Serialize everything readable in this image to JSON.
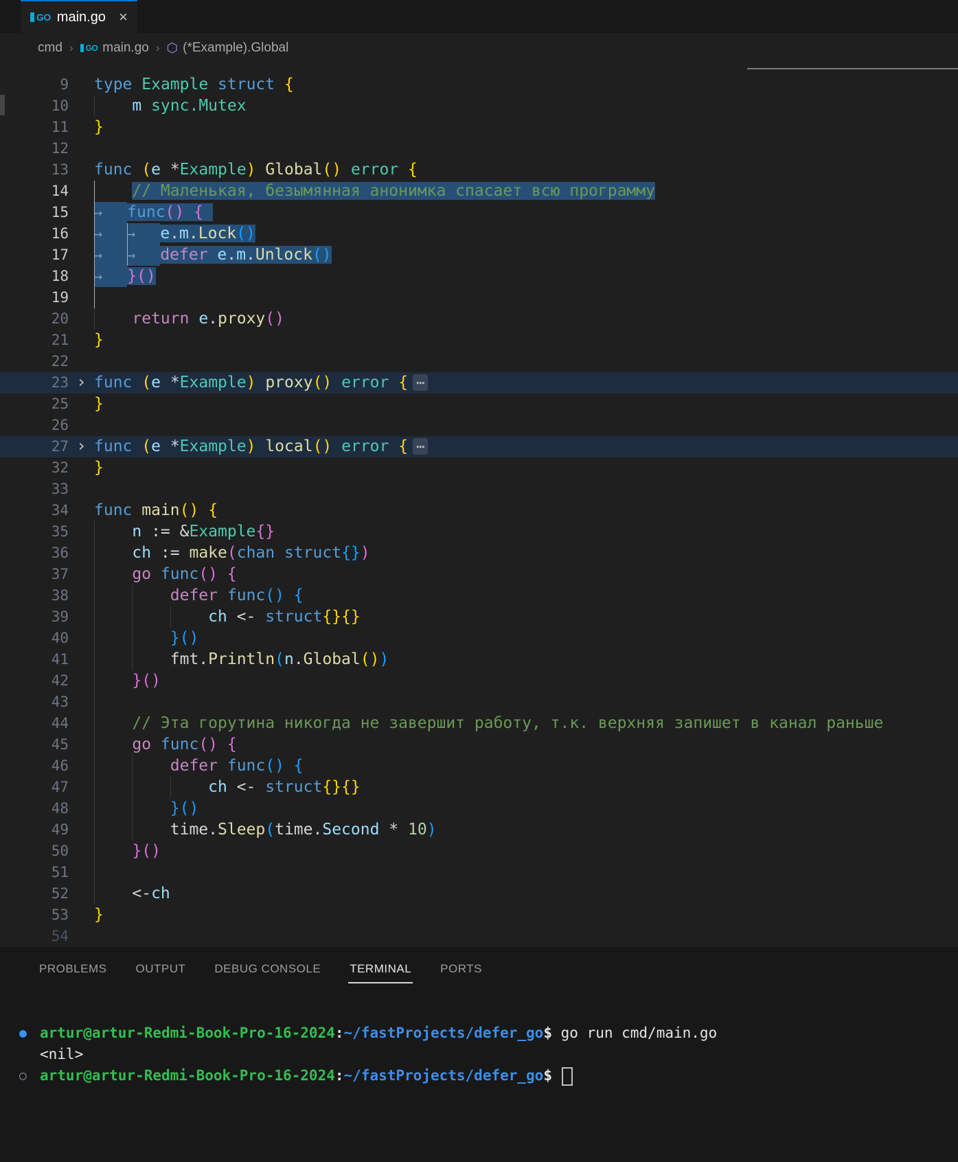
{
  "colors": {
    "accent": "#0078d4",
    "editor_background": "#1f1f1f",
    "panel_background": "#181818",
    "selection": "#264F78",
    "terminal_green": "#2fbf4f",
    "terminal_blue": "#3b8eea",
    "go_brand": "#00acd7"
  },
  "icons": {
    "go": "GO",
    "symbol_method": "⬡",
    "close": "×",
    "crumb_separator": "›",
    "fold_chevron": "›",
    "tab_arrow": "→",
    "fold_ellipsis": "⋯",
    "decoration_filled": "●",
    "decoration_outline": "○"
  },
  "tab": {
    "title": "main.go"
  },
  "breadcrumb": {
    "items": [
      "cmd",
      "main.go",
      "(*Example).Global"
    ]
  },
  "editor": {
    "lines": [
      {
        "n": "9",
        "tokens": [
          {
            "t": "type ",
            "c": "kw"
          },
          {
            "t": "Example ",
            "c": "typ"
          },
          {
            "t": "struct ",
            "c": "kw"
          },
          {
            "t": "{",
            "c": "b1"
          }
        ]
      },
      {
        "n": "10",
        "tokens": [
          {
            "c": "ig"
          },
          {
            "t": "m ",
            "c": "vr"
          },
          {
            "t": "sync.Mutex",
            "c": "typ"
          }
        ]
      },
      {
        "n": "11",
        "tokens": [
          {
            "t": "}",
            "c": "b1"
          }
        ]
      },
      {
        "n": "12",
        "tokens": []
      },
      {
        "n": "13",
        "tokens": [
          {
            "t": "func ",
            "c": "kw"
          },
          {
            "t": "(",
            "c": "b1"
          },
          {
            "t": "e",
            "c": "vr"
          },
          {
            "t": " *",
            "c": "pl"
          },
          {
            "t": "Example",
            "c": "typ"
          },
          {
            "t": ") ",
            "c": "b1"
          },
          {
            "t": "Global",
            "c": "fn"
          },
          {
            "t": "() ",
            "c": "b1"
          },
          {
            "t": "error ",
            "c": "typ"
          },
          {
            "t": "{",
            "c": "b1"
          }
        ]
      },
      {
        "n": "14",
        "hl": 1,
        "tokens": [
          {
            "c": "igA"
          },
          {
            "t": "// Маленькая, безымянная анонимка спасает всю программу",
            "c": "cm",
            "s": 1
          }
        ]
      },
      {
        "n": "15",
        "hl": 1,
        "tokens": [
          {
            "c": "ws"
          },
          {
            "t": "func",
            "c": "kw",
            "s": 1
          },
          {
            "t": "()",
            "c": "b2",
            "s": 1
          },
          {
            "t": " ",
            "c": "pl",
            "s": 1
          },
          {
            "t": "{ ",
            "c": "b2",
            "s": 1
          }
        ]
      },
      {
        "n": "16",
        "hl": 1,
        "tokens": [
          {
            "c": "ws"
          },
          {
            "c": "ws"
          },
          {
            "t": "e",
            "c": "vr",
            "s": 1
          },
          {
            "t": ".",
            "c": "pl",
            "s": 1
          },
          {
            "t": "m",
            "c": "vr",
            "s": 1
          },
          {
            "t": ".",
            "c": "pl",
            "s": 1
          },
          {
            "t": "Lock",
            "c": "fn",
            "s": 1
          },
          {
            "t": "()",
            "c": "b3",
            "s": 1
          }
        ]
      },
      {
        "n": "17",
        "hl": 1,
        "tokens": [
          {
            "c": "ws"
          },
          {
            "c": "ws"
          },
          {
            "t": "defer ",
            "c": "ctrl",
            "s": 1
          },
          {
            "t": "e",
            "c": "vr",
            "s": 1
          },
          {
            "t": ".",
            "c": "pl",
            "s": 1
          },
          {
            "t": "m",
            "c": "vr",
            "s": 1
          },
          {
            "t": ".",
            "c": "pl",
            "s": 1
          },
          {
            "t": "Unlock",
            "c": "fn",
            "s": 1
          },
          {
            "t": "()",
            "c": "b3",
            "s": 1
          }
        ]
      },
      {
        "n": "18",
        "hl": 1,
        "tokens": [
          {
            "c": "ws"
          },
          {
            "t": "}()",
            "c": "b2",
            "s": 1
          }
        ]
      },
      {
        "n": "19",
        "hl": 1,
        "tokens": [
          {
            "c": "igA"
          }
        ]
      },
      {
        "n": "20",
        "tokens": [
          {
            "c": "ig"
          },
          {
            "t": "return ",
            "c": "ctrl"
          },
          {
            "t": "e",
            "c": "vr"
          },
          {
            "t": ".",
            "c": "pl"
          },
          {
            "t": "proxy",
            "c": "fn"
          },
          {
            "t": "()",
            "c": "b2"
          }
        ]
      },
      {
        "n": "21",
        "tokens": [
          {
            "t": "}",
            "c": "b1"
          }
        ]
      },
      {
        "n": "22",
        "tokens": []
      },
      {
        "n": "23",
        "fold": 1,
        "tokens": [
          {
            "t": "func ",
            "c": "kw"
          },
          {
            "t": "(",
            "c": "b1"
          },
          {
            "t": "e",
            "c": "vr"
          },
          {
            "t": " *",
            "c": "pl"
          },
          {
            "t": "Example",
            "c": "typ"
          },
          {
            "t": ") ",
            "c": "b1"
          },
          {
            "t": "proxy",
            "c": "fn"
          },
          {
            "t": "() ",
            "c": "b1"
          },
          {
            "t": "error ",
            "c": "typ"
          },
          {
            "t": "{",
            "c": "b1"
          },
          {
            "t": "⋯",
            "c": "fold"
          }
        ]
      },
      {
        "n": "25",
        "tokens": [
          {
            "t": "}",
            "c": "b1"
          }
        ]
      },
      {
        "n": "26",
        "tokens": []
      },
      {
        "n": "27",
        "fold": 1,
        "tokens": [
          {
            "t": "func ",
            "c": "kw"
          },
          {
            "t": "(",
            "c": "b1"
          },
          {
            "t": "e",
            "c": "vr"
          },
          {
            "t": " *",
            "c": "pl"
          },
          {
            "t": "Example",
            "c": "typ"
          },
          {
            "t": ") ",
            "c": "b1"
          },
          {
            "t": "local",
            "c": "fn"
          },
          {
            "t": "() ",
            "c": "b1"
          },
          {
            "t": "error ",
            "c": "typ"
          },
          {
            "t": "{",
            "c": "b1"
          },
          {
            "t": "⋯",
            "c": "fold"
          }
        ]
      },
      {
        "n": "32",
        "tokens": [
          {
            "t": "}",
            "c": "b1"
          }
        ]
      },
      {
        "n": "33",
        "tokens": []
      },
      {
        "n": "34",
        "tokens": [
          {
            "t": "func ",
            "c": "kw"
          },
          {
            "t": "main",
            "c": "fn"
          },
          {
            "t": "() ",
            "c": "b1"
          },
          {
            "t": "{",
            "c": "b1"
          }
        ]
      },
      {
        "n": "35",
        "tokens": [
          {
            "c": "ig"
          },
          {
            "t": "n ",
            "c": "vr"
          },
          {
            "t": ":= &",
            "c": "pl"
          },
          {
            "t": "Example",
            "c": "typ"
          },
          {
            "t": "{}",
            "c": "b2"
          }
        ]
      },
      {
        "n": "36",
        "tokens": [
          {
            "c": "ig"
          },
          {
            "t": "ch ",
            "c": "vr"
          },
          {
            "t": ":= ",
            "c": "pl"
          },
          {
            "t": "make",
            "c": "fn"
          },
          {
            "t": "(",
            "c": "b2"
          },
          {
            "t": "chan ",
            "c": "kw"
          },
          {
            "t": "struct",
            "c": "kw"
          },
          {
            "t": "{}",
            "c": "b3"
          },
          {
            "t": ")",
            "c": "b2"
          }
        ]
      },
      {
        "n": "37",
        "tokens": [
          {
            "c": "ig"
          },
          {
            "t": "go ",
            "c": "ctrl"
          },
          {
            "t": "func",
            "c": "kw"
          },
          {
            "t": "()",
            "c": "b2"
          },
          {
            "t": " ",
            "c": "pl"
          },
          {
            "t": "{",
            "c": "b2"
          }
        ]
      },
      {
        "n": "38",
        "tokens": [
          {
            "c": "ig"
          },
          {
            "c": "ig"
          },
          {
            "t": "defer ",
            "c": "ctrl"
          },
          {
            "t": "func",
            "c": "kw"
          },
          {
            "t": "()",
            "c": "b3"
          },
          {
            "t": " ",
            "c": "pl"
          },
          {
            "t": "{",
            "c": "b3"
          }
        ]
      },
      {
        "n": "39",
        "tokens": [
          {
            "c": "ig"
          },
          {
            "c": "ig"
          },
          {
            "c": "ig"
          },
          {
            "t": "ch ",
            "c": "vr"
          },
          {
            "t": "<- ",
            "c": "pl"
          },
          {
            "t": "struct",
            "c": "kw"
          },
          {
            "t": "{}{}",
            "c": "b1"
          }
        ]
      },
      {
        "n": "40",
        "tokens": [
          {
            "c": "ig"
          },
          {
            "c": "ig"
          },
          {
            "t": "}()",
            "c": "b3"
          }
        ]
      },
      {
        "n": "41",
        "tokens": [
          {
            "c": "ig"
          },
          {
            "c": "ig"
          },
          {
            "t": "fmt",
            "c": "pl"
          },
          {
            "t": ".",
            "c": "pl"
          },
          {
            "t": "Println",
            "c": "fn"
          },
          {
            "t": "(",
            "c": "b3"
          },
          {
            "t": "n",
            "c": "vr"
          },
          {
            "t": ".",
            "c": "pl"
          },
          {
            "t": "Global",
            "c": "fn"
          },
          {
            "t": "()",
            "c": "b1"
          },
          {
            "t": ")",
            "c": "b3"
          }
        ]
      },
      {
        "n": "42",
        "tokens": [
          {
            "c": "ig"
          },
          {
            "t": "}()",
            "c": "b2"
          }
        ]
      },
      {
        "n": "43",
        "tokens": [
          {
            "c": "ig"
          }
        ]
      },
      {
        "n": "44",
        "tokens": [
          {
            "c": "ig"
          },
          {
            "t": "// Эта горутина никогда не завершит работу, т.к. верхняя запишет в канал раньше",
            "c": "cm"
          }
        ]
      },
      {
        "n": "45",
        "tokens": [
          {
            "c": "ig"
          },
          {
            "t": "go ",
            "c": "ctrl"
          },
          {
            "t": "func",
            "c": "kw"
          },
          {
            "t": "()",
            "c": "b2"
          },
          {
            "t": " ",
            "c": "pl"
          },
          {
            "t": "{",
            "c": "b2"
          }
        ]
      },
      {
        "n": "46",
        "tokens": [
          {
            "c": "ig"
          },
          {
            "c": "ig"
          },
          {
            "t": "defer ",
            "c": "ctrl"
          },
          {
            "t": "func",
            "c": "kw"
          },
          {
            "t": "()",
            "c": "b3"
          },
          {
            "t": " ",
            "c": "pl"
          },
          {
            "t": "{",
            "c": "b3"
          }
        ]
      },
      {
        "n": "47",
        "tokens": [
          {
            "c": "ig"
          },
          {
            "c": "ig"
          },
          {
            "c": "ig"
          },
          {
            "t": "ch ",
            "c": "vr"
          },
          {
            "t": "<- ",
            "c": "pl"
          },
          {
            "t": "struct",
            "c": "kw"
          },
          {
            "t": "{}{}",
            "c": "b1"
          }
        ]
      },
      {
        "n": "48",
        "tokens": [
          {
            "c": "ig"
          },
          {
            "c": "ig"
          },
          {
            "t": "}()",
            "c": "b3"
          }
        ]
      },
      {
        "n": "49",
        "tokens": [
          {
            "c": "ig"
          },
          {
            "c": "ig"
          },
          {
            "t": "time",
            "c": "pl"
          },
          {
            "t": ".",
            "c": "pl"
          },
          {
            "t": "Sleep",
            "c": "fn"
          },
          {
            "t": "(",
            "c": "b3"
          },
          {
            "t": "time",
            "c": "pl"
          },
          {
            "t": ".",
            "c": "pl"
          },
          {
            "t": "Second",
            "c": "vr"
          },
          {
            "t": " * ",
            "c": "pl"
          },
          {
            "t": "10",
            "c": "num"
          },
          {
            "t": ")",
            "c": "b3"
          }
        ]
      },
      {
        "n": "50",
        "tokens": [
          {
            "c": "ig"
          },
          {
            "t": "}()",
            "c": "b2"
          }
        ]
      },
      {
        "n": "51",
        "tokens": [
          {
            "c": "ig"
          }
        ]
      },
      {
        "n": "52",
        "tokens": [
          {
            "c": "ig"
          },
          {
            "t": "<-",
            "c": "pl"
          },
          {
            "t": "ch",
            "c": "vr"
          }
        ]
      },
      {
        "n": "53",
        "tokens": [
          {
            "t": "}",
            "c": "b1"
          }
        ]
      },
      {
        "n": "54",
        "dim": 1,
        "tokens": []
      }
    ]
  },
  "panel": {
    "tabs": [
      {
        "label": "PROBLEMS",
        "active": false
      },
      {
        "label": "OUTPUT",
        "active": false
      },
      {
        "label": "DEBUG CONSOLE",
        "active": false
      },
      {
        "label": "TERMINAL",
        "active": true
      },
      {
        "label": "PORTS",
        "active": false
      }
    ]
  },
  "terminal": {
    "lines": [
      {
        "dec": "filled",
        "tokens": [
          {
            "t": "artur@artur-Redmi-Book-Pro-16-2024",
            "c": "tg"
          },
          {
            "t": ":",
            "c": "tp"
          },
          {
            "t": "~/fastProjects/defer_go",
            "c": "tb"
          },
          {
            "t": "$ ",
            "c": "tp"
          },
          {
            "t": "go run cmd/main.go",
            "c": "tn"
          }
        ]
      },
      {
        "dec": "",
        "tokens": [
          {
            "t": "<nil>",
            "c": "tn"
          }
        ]
      },
      {
        "dec": "outline",
        "cursor": true,
        "tokens": [
          {
            "t": "artur@artur-Redmi-Book-Pro-16-2024",
            "c": "tg"
          },
          {
            "t": ":",
            "c": "tp"
          },
          {
            "t": "~/fastProjects/defer_go",
            "c": "tb"
          },
          {
            "t": "$ ",
            "c": "tp"
          }
        ]
      }
    ]
  }
}
